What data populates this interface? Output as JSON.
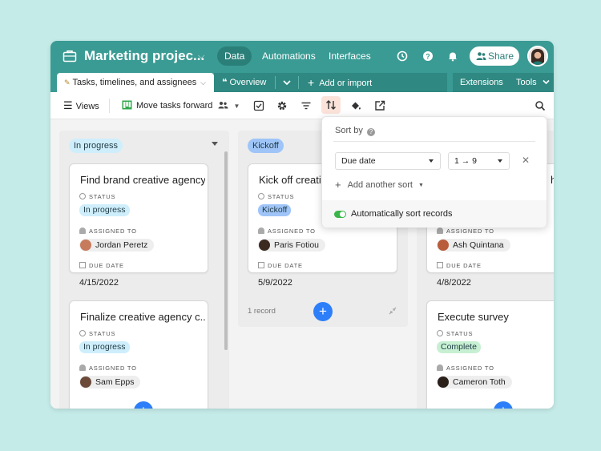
{
  "header": {
    "title": "Marketing projec...",
    "nav_tabs": [
      {
        "label": "Data",
        "active": true
      },
      {
        "label": "Automations",
        "active": false
      },
      {
        "label": "Interfaces",
        "active": false
      }
    ],
    "share_label": "Share"
  },
  "tabs": {
    "active_table": "Tasks, timelines, and assignees",
    "view_label": "Overview",
    "add_import": "Add or import",
    "extensions": "Extensions",
    "tools": "Tools"
  },
  "toolbar": {
    "views": "Views",
    "view_name": "Move tasks forward"
  },
  "labels": {
    "status": "STATUS",
    "assigned_to": "ASSIGNED TO",
    "due_date": "DUE DATE"
  },
  "columns": [
    {
      "name": "In progress",
      "cards": [
        {
          "title": "Find brand creative agency",
          "status": "In progress",
          "assignee": "Jordan Peretz",
          "due": "4/15/2022"
        },
        {
          "title": "Finalize creative agency c...",
          "status": "In progress",
          "assignee": "Sam Epps"
        }
      ]
    },
    {
      "name": "Kickoff",
      "record_count": "1 record",
      "cards": [
        {
          "title": "Kick off creati",
          "status": "Kickoff",
          "assignee": "Paris Fotiou",
          "due": "5/9/2022"
        }
      ]
    },
    {
      "name": "",
      "cards": [
        {
          "title": "h",
          "assignee": "Ash Quintana",
          "due": "4/8/2022"
        },
        {
          "title": "Execute survey",
          "status": "Complete",
          "assignee": "Cameron Toth"
        }
      ]
    }
  ],
  "sort": {
    "title": "Sort by",
    "field": "Due date",
    "direction": "1 → 9",
    "add_another": "Add another sort",
    "auto_sort": "Automatically sort records",
    "auto_sort_on": true
  },
  "colors": {
    "header": "#3a9b94",
    "in_progress": "#cfeefc",
    "kickoff": "#9fc5f8",
    "complete": "#c7f0d3",
    "add_button": "#2d7ff9"
  }
}
